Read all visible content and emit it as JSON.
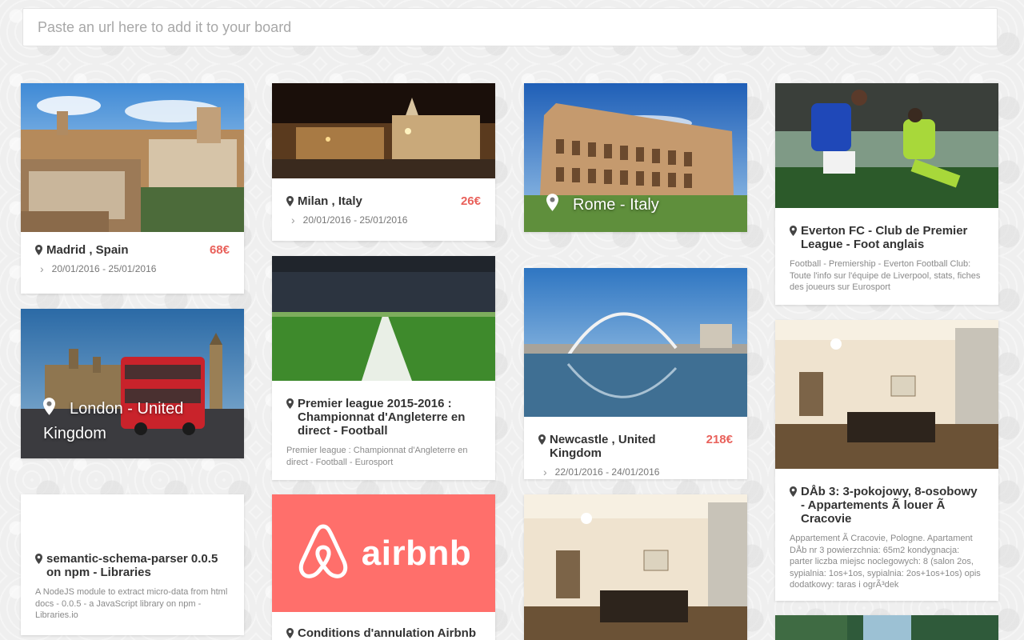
{
  "url_input": {
    "placeholder": "Paste an url here to add it to your board"
  },
  "cards": {
    "madrid": {
      "title": "Madrid , Spain",
      "price": "68€",
      "dates": "20/01/2016 - 25/01/2016"
    },
    "london": {
      "overlay_title_line1": "London - United",
      "overlay_title_line2": "Kingdom"
    },
    "schema": {
      "title": "semantic-schema-parser 0.0.5 on npm - Libraries",
      "description": "A NodeJS module to extract micro-data from html docs - 0.0.5 - a JavaScript library on npm - Libraries.io"
    },
    "milan": {
      "title": "Milan , Italy",
      "price": "26€",
      "dates": "20/01/2016 - 25/01/2016"
    },
    "premier": {
      "title": "Premier league 2015-2016 : Championnat d'Angleterre en direct - Football",
      "description": "Premier league : Championnat d'Angleterre en direct - Football - Eurosport"
    },
    "airbnb": {
      "logo_text": "airbnb",
      "title": "Conditions d'annulation Airbnb"
    },
    "rome": {
      "overlay_title": "Rome - Italy"
    },
    "newcastle": {
      "title": "Newcastle , United Kingdom",
      "price": "218€",
      "dates": "22/01/2016 - 24/01/2016"
    },
    "everton": {
      "title": "Everton FC - Club de Premier League - Foot anglais",
      "description": "Football - Premiership - Everton Football Club: Toute l'info sur l'équipe de Liverpool, stats, fiches des joueurs sur Eurosport"
    },
    "cracow": {
      "title": "DÅb 3: 3-pokojowy, 8-osobowy - Appartements Ã louer Ã Cracovie",
      "description": "Appartement Ã Cracovie, Pologne. Apartament DÅb nr 3 powierzchnia: 65m2 kondygnacja: parter liczba miejsc noclegowych: 8 (salon 2os, sypialnia: 1os+1os, sypialnia: 2os+1os+1os) opis dodatkowy: taras i ogrÃ³dek"
    }
  },
  "colors": {
    "accent_price": "#e9615b",
    "airbnb_brand": "#ff6f6b"
  }
}
